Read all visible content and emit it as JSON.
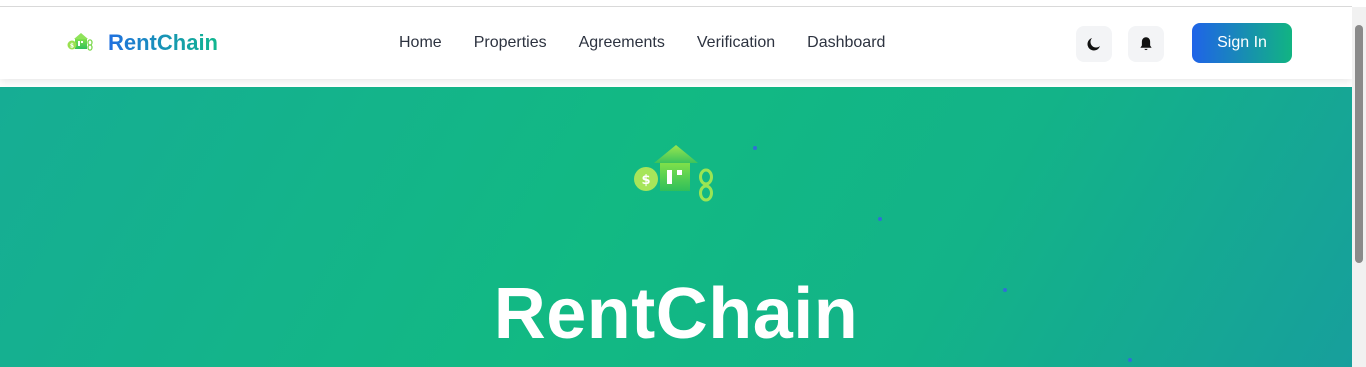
{
  "brand": {
    "name": "RentChain",
    "logo_icon": "house-coin-chain-logo"
  },
  "nav": {
    "links": [
      {
        "label": "Home"
      },
      {
        "label": "Properties"
      },
      {
        "label": "Agreements"
      },
      {
        "label": "Verification"
      },
      {
        "label": "Dashboard"
      }
    ]
  },
  "actions": {
    "theme_toggle_icon": "moon-icon",
    "notifications_icon": "bell-icon",
    "sign_in_label": "Sign In"
  },
  "hero": {
    "logo_icon": "house-coin-chain-logo",
    "coin_symbol": "$",
    "title": "RentChain"
  },
  "colors": {
    "brand_blue": "#1f63e8",
    "brand_green": "#11b482",
    "hero_teal": "#12b983"
  }
}
